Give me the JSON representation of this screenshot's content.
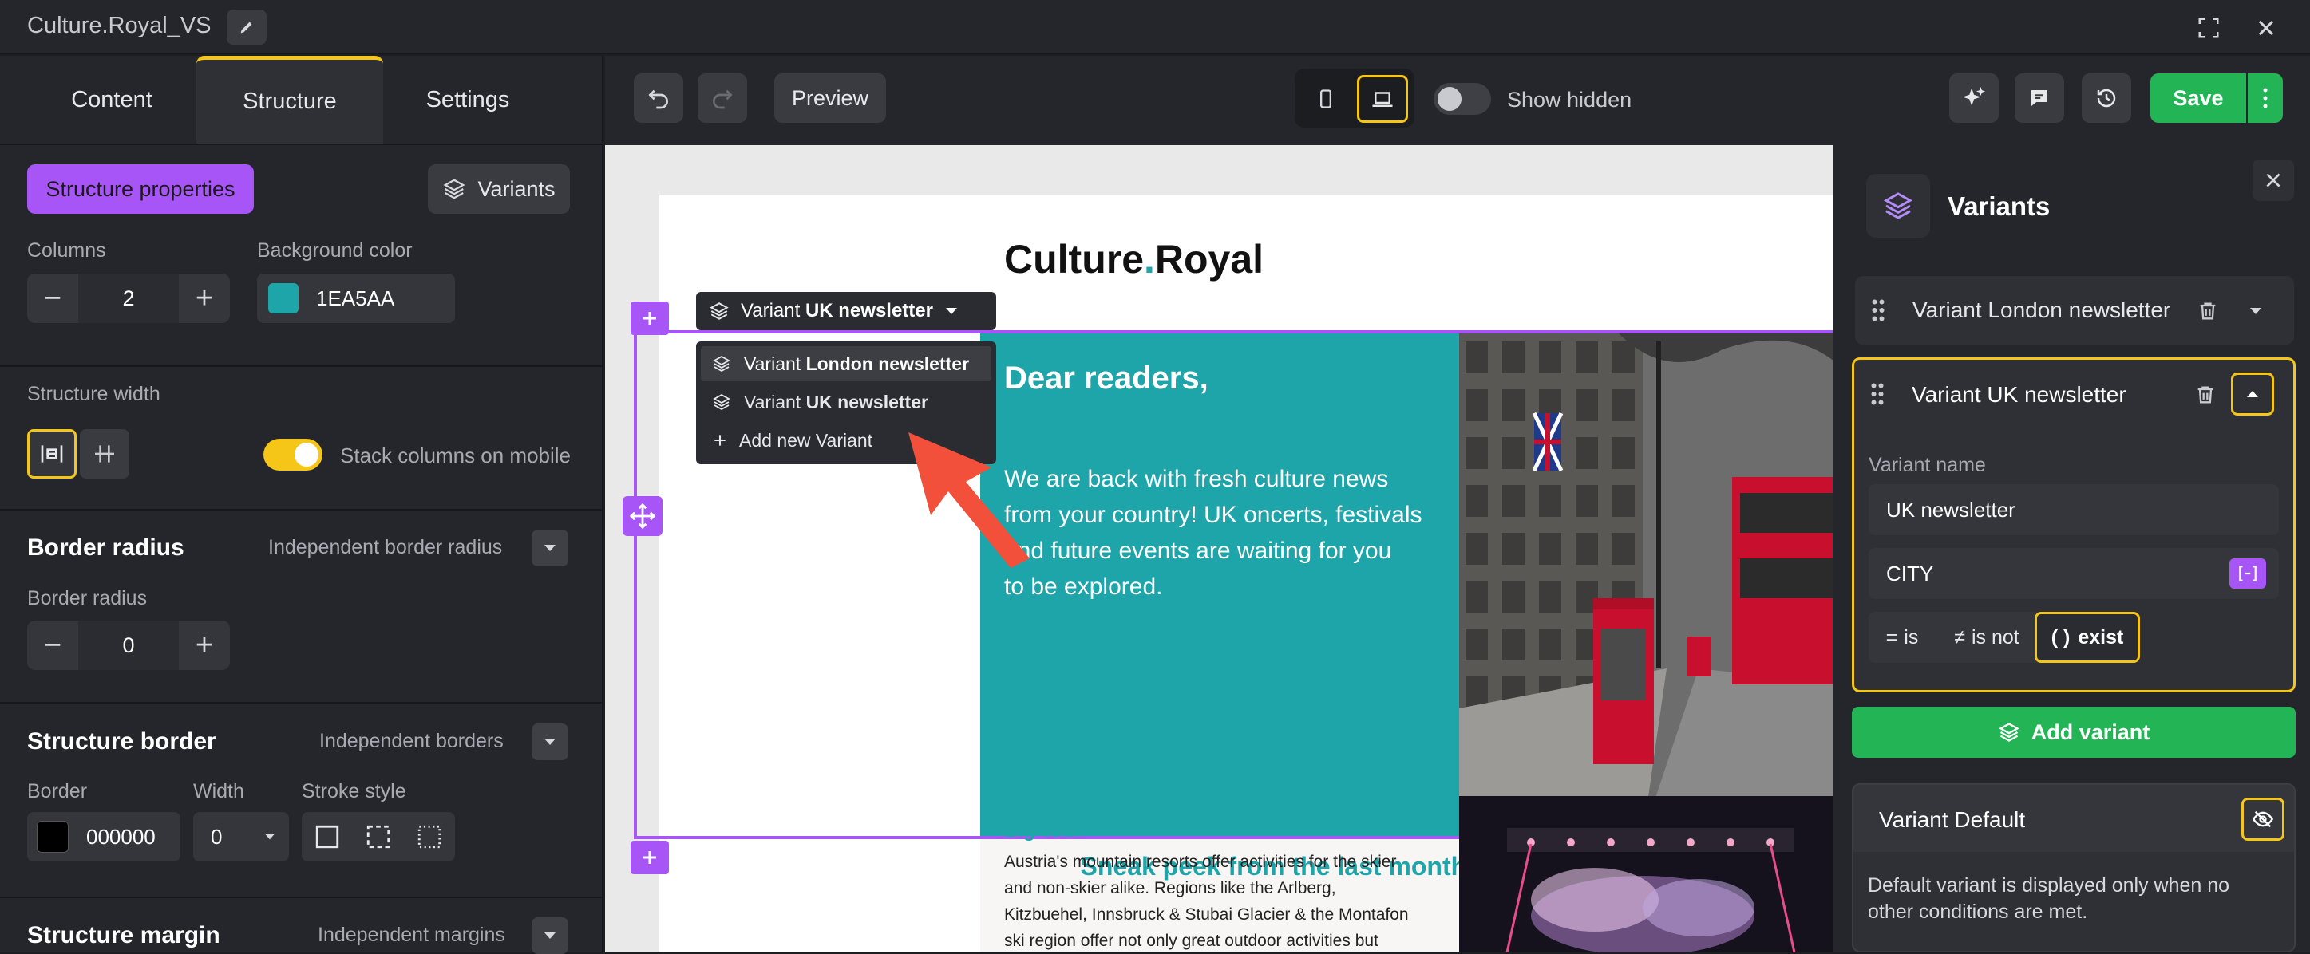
{
  "app": {
    "title": "Culture.Royal_VS"
  },
  "left_tabs": [
    {
      "label": "Content"
    },
    {
      "label": "Structure"
    },
    {
      "label": "Settings"
    }
  ],
  "structure": {
    "properties_btn": "Structure properties",
    "variants_btn": "Variants",
    "columns_label": "Columns",
    "columns_value": "2",
    "bg_label": "Background color",
    "bg_value": "1EA5AA",
    "bg_color": "#1EA5AA",
    "width_label": "Structure width",
    "stack_label": "Stack columns on mobile",
    "border_radius_title": "Border radius",
    "border_radius_sub": "Independent border radius",
    "border_radius_label": "Border radius",
    "border_radius_value": "0",
    "border_title": "Structure border",
    "border_sub": "Independent borders",
    "border_label": "Border",
    "border_value": "000000",
    "width2_label": "Width",
    "width2_value": "0",
    "stroke_label": "Stroke style",
    "margin_title": "Structure margin",
    "margin_sub": "Independent margins"
  },
  "toolbar": {
    "preview": "Preview",
    "show_hidden": "Show hidden",
    "save": "Save"
  },
  "canvas": {
    "logo_a": "Culture",
    "logo_dot": ".",
    "logo_b": "Royal",
    "variant_chip_prefix": "Variant ",
    "variant_chip_name": "UK newsletter",
    "menu": [
      {
        "prefix": "Variant ",
        "name": "London newsletter"
      },
      {
        "prefix": "Variant ",
        "name": "UK newsletter"
      }
    ],
    "menu_add": "Add new Variant",
    "heading": "Dear readers,",
    "body_lines": [
      "We are back with fresh culture news",
      "from your country! UK oncerts, festivals",
      "and future events are waiting for you",
      "to be explored."
    ],
    "sneak": "Sneak peek from the last month of culture!",
    "tour_title": "Big Tour",
    "tour_lines": [
      "Austria's mountain resorts offer activities for the skier",
      "and non-skier alike. Regions like the Arlberg,",
      "Kitzbuehel, Innsbruck & Stubai Glacier & the Montafon",
      "ski region offer not only great outdoor activities but"
    ]
  },
  "variants_panel": {
    "title": "Variants",
    "london": "Variant London newsletter",
    "uk": "Variant UK newsletter",
    "name_label": "Variant name",
    "name_value": "UK newsletter",
    "condition_field": "CITY",
    "op_is": "is",
    "op_is_not": "is not",
    "op_exist": "exist",
    "add_variant": "Add variant",
    "default_title": "Variant Default",
    "default_desc_1": "Default variant is displayed only when no",
    "default_desc_2": "other conditions are met."
  },
  "colors": {
    "accent": "#f5c518",
    "purple": "#a855f7",
    "teal": "#1EA5AA",
    "green": "#22b455",
    "arrow": "#f2503a"
  }
}
